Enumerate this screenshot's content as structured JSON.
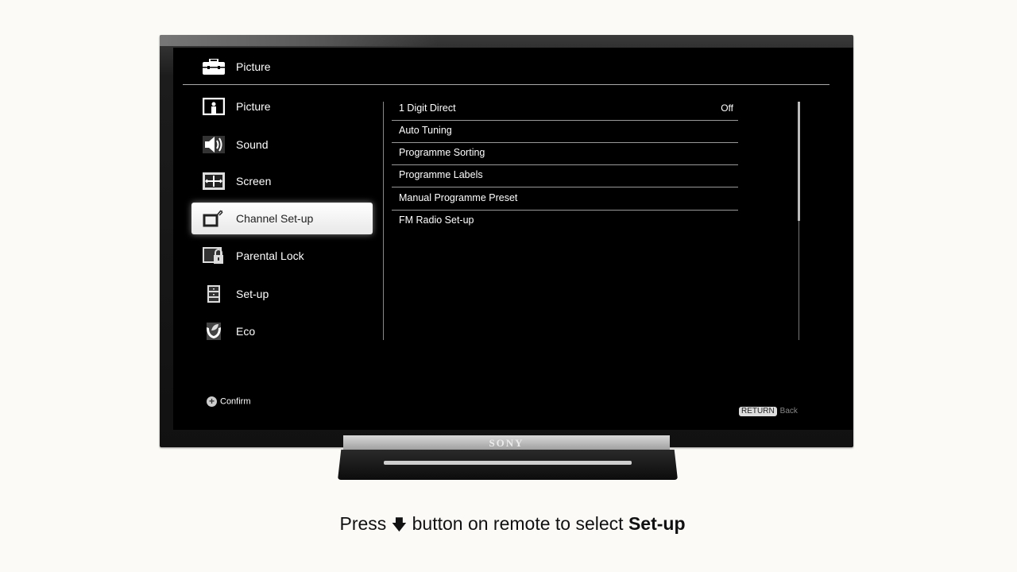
{
  "header": {
    "title": "Picture",
    "icon": "toolbox-icon"
  },
  "nav": {
    "items": [
      {
        "label": "Picture",
        "icon": "picture-icon",
        "selected": false
      },
      {
        "label": "Sound",
        "icon": "speaker-icon",
        "selected": false
      },
      {
        "label": "Screen",
        "icon": "screen-icon",
        "selected": false
      },
      {
        "label": "Channel Set-up",
        "icon": "channel-antenna-icon",
        "selected": true
      },
      {
        "label": "Parental Lock",
        "icon": "lock-icon",
        "selected": false
      },
      {
        "label": "Set-up",
        "icon": "cabinet-icon",
        "selected": false
      },
      {
        "label": "Eco",
        "icon": "eco-leaf-icon",
        "selected": false
      }
    ]
  },
  "submenu": {
    "items": [
      {
        "label": "1 Digit Direct",
        "value": "Off"
      },
      {
        "label": "Auto Tuning",
        "value": ""
      },
      {
        "label": "Programme Sorting",
        "value": ""
      },
      {
        "label": "Programme Labels",
        "value": ""
      },
      {
        "label": "Manual Programme Preset",
        "value": ""
      },
      {
        "label": "FM Radio Set-up",
        "value": ""
      }
    ],
    "scroll_visible_fraction": 0.5
  },
  "footer": {
    "confirm_icon": "plus-circle-icon",
    "confirm_label": "Confirm",
    "return_badge": "RETURN",
    "back_label": "Back"
  },
  "stand": {
    "brand": "SONY"
  },
  "caption": {
    "prefix": "Press",
    "arrow": "🡇",
    "middle": "button on remote to select",
    "bold": "Set-up"
  }
}
